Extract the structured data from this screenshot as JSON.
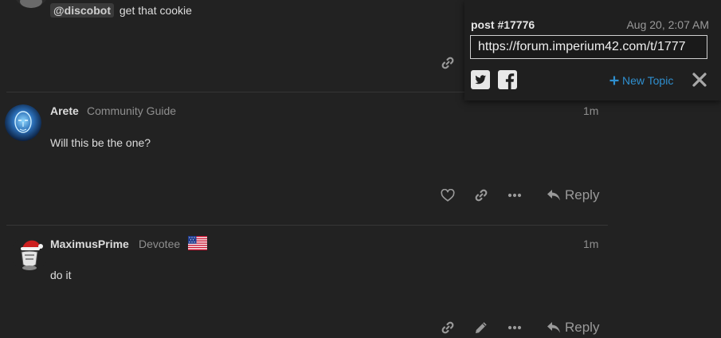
{
  "post1": {
    "mention": "@discobot",
    "text": "get that cookie"
  },
  "post2": {
    "author": "Arete",
    "user_title": "Community Guide",
    "age": "1m",
    "body": "Will this be the one?",
    "reply_label": "Reply"
  },
  "post3": {
    "author": "MaximusPrime",
    "user_title": "Devotee",
    "age": "1m",
    "body": "do it",
    "reply_label": "Reply"
  },
  "share": {
    "post_label": "post #17776",
    "date": "Aug 20, 2:07 AM",
    "url": "https://forum.imperium42.com/t/1777",
    "new_topic_label": "New Topic"
  },
  "icons": {
    "link": "link-icon",
    "like": "heart-icon",
    "more": "ellipsis-icon",
    "reply": "reply-arrow-icon",
    "edit": "pencil-icon",
    "twitter": "twitter-icon",
    "facebook": "facebook-icon",
    "plus": "plus-icon",
    "close": "close-icon",
    "flag": "us-flag-icon"
  },
  "colors": {
    "background": "#222222",
    "accent": "#2f8fcf",
    "muted": "#8f8f8f"
  }
}
